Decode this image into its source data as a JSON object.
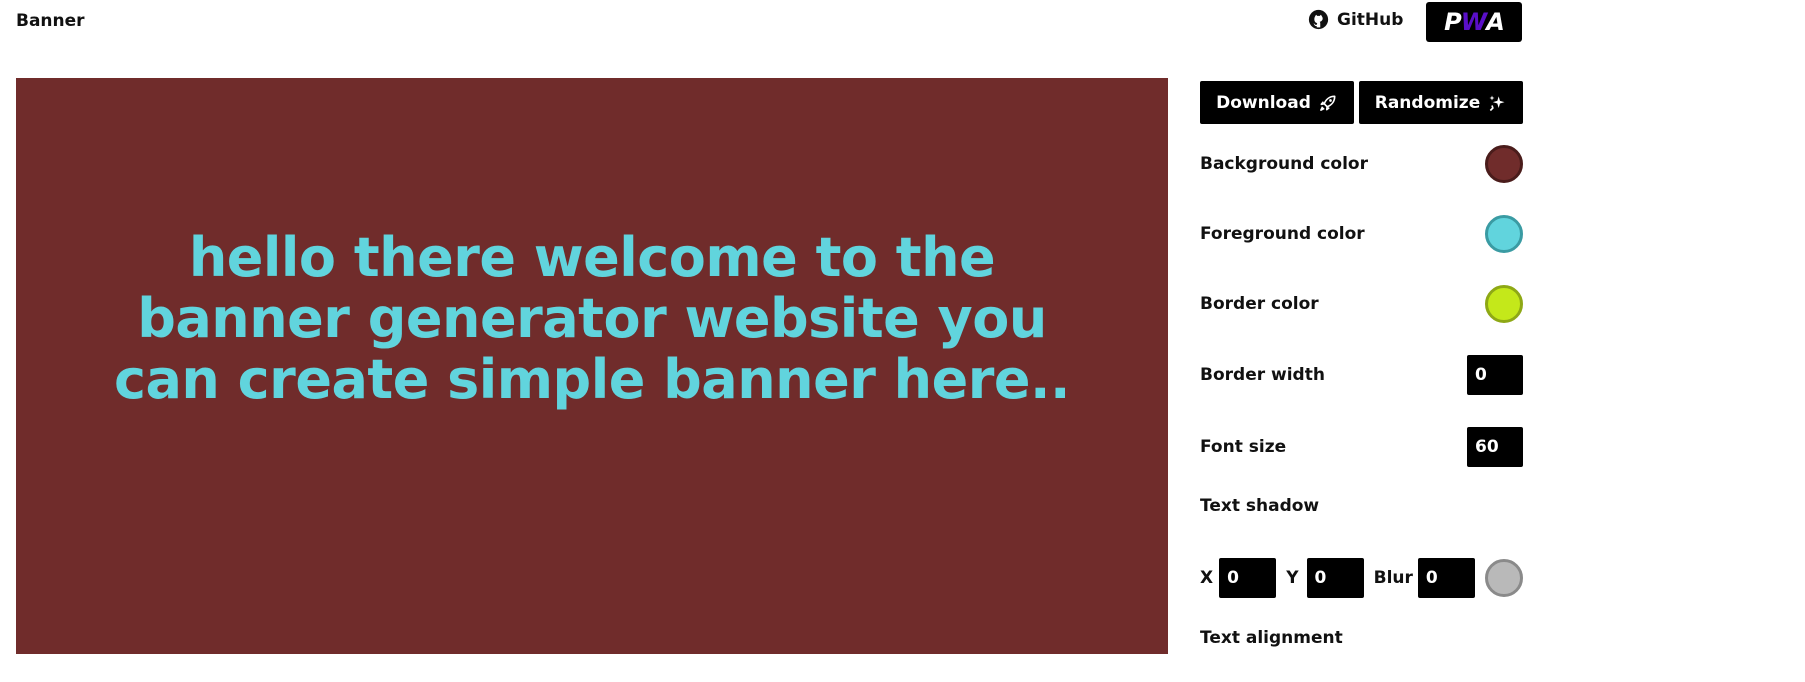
{
  "header": {
    "brand": "Banner",
    "github_label": "GitHub",
    "pwa_label_p": "P",
    "pwa_label_w": "W",
    "pwa_label_a": "A"
  },
  "banner": {
    "text": "hello there welcome to the banner generator website you can create simple banner here..",
    "background_color": "#702c2b",
    "foreground_color": "#61d4dd"
  },
  "controls": {
    "download_label": "Download",
    "randomize_label": "Randomize",
    "background_color_label": "Background color",
    "foreground_color_label": "Foreground color",
    "border_color_label": "Border color",
    "border_width_label": "Border width",
    "border_width_value": "0",
    "font_size_label": "Font size",
    "font_size_value": "60",
    "text_shadow_label": "Text shadow",
    "shadow_x_label": "X",
    "shadow_x_value": "0",
    "shadow_y_label": "Y",
    "shadow_y_value": "0",
    "shadow_blur_label": "Blur",
    "shadow_blur_value": "0",
    "text_alignment_label": "Text alignment"
  },
  "colors": {
    "background": "#702c2b",
    "foreground": "#61d4dd",
    "border": "#c4e81a",
    "shadow": "#b9b9b9"
  },
  "icons": {
    "github": "github-icon",
    "download": "rocket-icon",
    "randomize": "sparkles-icon"
  }
}
